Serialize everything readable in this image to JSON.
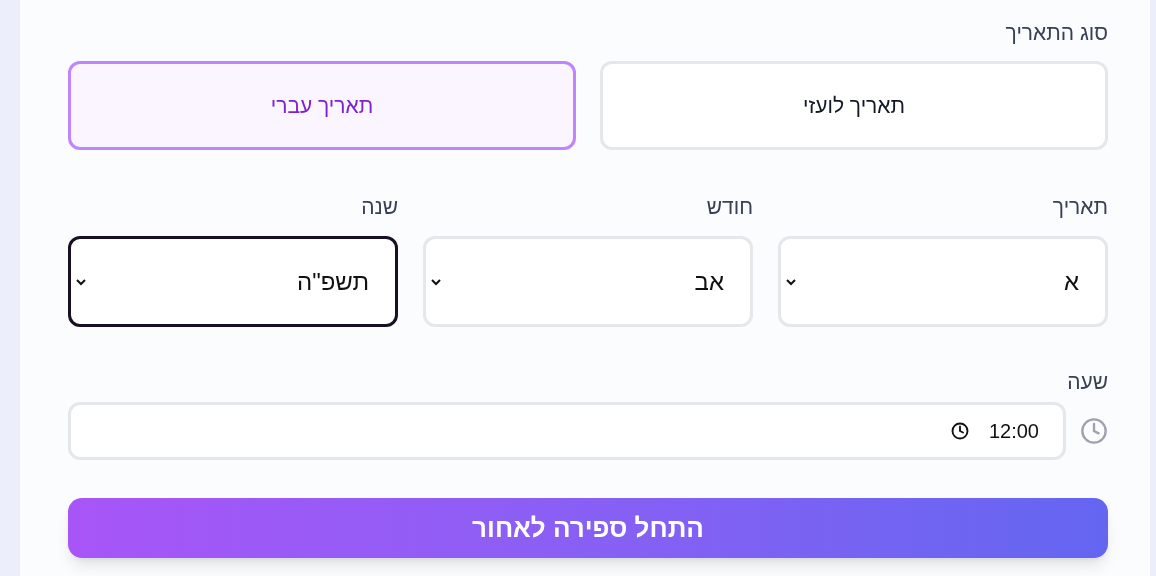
{
  "date_type": {
    "label": "סוג התאריך",
    "options": [
      {
        "label": "תאריך לועזי",
        "selected": false
      },
      {
        "label": "תאריך עברי",
        "selected": true
      }
    ]
  },
  "fields": [
    {
      "label": "תאריך",
      "value": "א",
      "focused": false
    },
    {
      "label": "חודש",
      "value": "אב",
      "focused": false
    },
    {
      "label": "שנה",
      "value": "תשפ\"ה",
      "focused": true
    }
  ],
  "time": {
    "label": "שעה",
    "value": "12:00"
  },
  "submit": "התחל ספירה לאחור"
}
